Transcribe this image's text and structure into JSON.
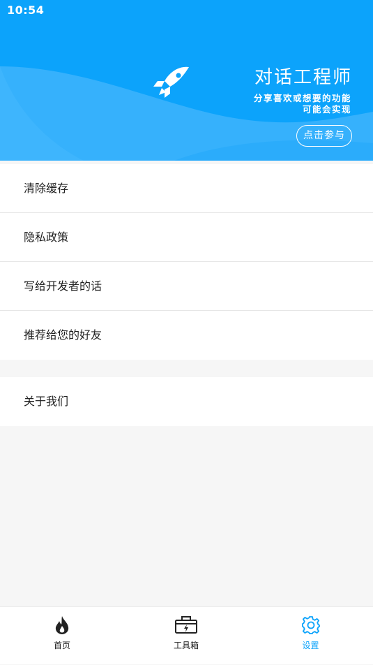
{
  "status_bar": {
    "time": "10:54"
  },
  "header": {
    "title": "对话工程师",
    "subtitle_line1": "分享喜欢或想要的功能",
    "subtitle_line2": "可能会实现",
    "join_button": "点击参与",
    "accent_color": "#0ca3fb"
  },
  "menu_groups": [
    {
      "items": [
        "清除缓存",
        "隐私政策",
        "写给开发者的话",
        "推荐给您的好友"
      ]
    },
    {
      "items": [
        "关于我们"
      ]
    }
  ],
  "tabbar": {
    "tabs": [
      {
        "label": "首页",
        "icon": "flame-icon"
      },
      {
        "label": "工具箱",
        "icon": "toolbox-icon"
      },
      {
        "label": "设置",
        "icon": "gear-icon",
        "active": true
      }
    ]
  }
}
